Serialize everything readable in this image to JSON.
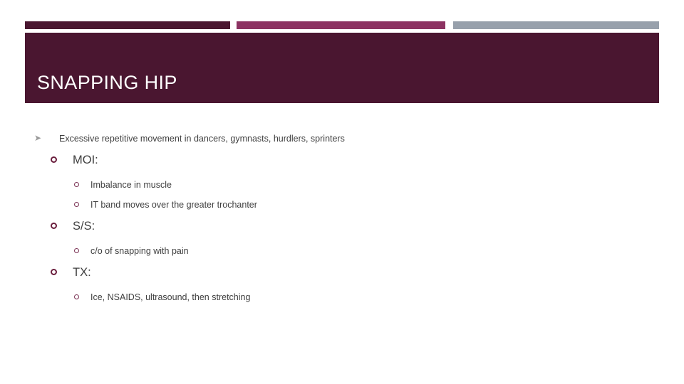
{
  "slide": {
    "title": "SNAPPING HIP",
    "accent_dark": "#4A1630",
    "accent_magenta": "#8C3262",
    "accent_gray": "#97A0AB",
    "bullet_maroon": "#6B1F3E",
    "text_color": "#3F3F3F",
    "background": "#FFFFFF"
  },
  "decor": {
    "bar_dark_label": "dark-maroon-bar",
    "bar_magenta_label": "magenta-bar",
    "bar_gray_label": "gray-bar"
  },
  "content": {
    "items": [
      {
        "level": 1,
        "marker": "arrow-bullet",
        "text": "Excessive repetitive movement in dancers, gymnasts, hurdlers, sprinters"
      },
      {
        "level": 2,
        "marker": "hollow-circle-bullet",
        "text": "MOI:"
      },
      {
        "level": 3,
        "marker": "hollow-circle-bullet-small",
        "text": "Imbalance in muscle"
      },
      {
        "level": 3,
        "marker": "hollow-circle-bullet-small",
        "text": "IT band moves over the greater trochanter"
      },
      {
        "level": 2,
        "marker": "hollow-circle-bullet",
        "text": "S/S:"
      },
      {
        "level": 3,
        "marker": "hollow-circle-bullet-small",
        "text": "c/o of snapping with pain"
      },
      {
        "level": 2,
        "marker": "hollow-circle-bullet",
        "text": "TX:"
      },
      {
        "level": 3,
        "marker": "hollow-circle-bullet-small",
        "text": "Ice, NSAIDS, ultrasound, then stretching"
      }
    ]
  }
}
